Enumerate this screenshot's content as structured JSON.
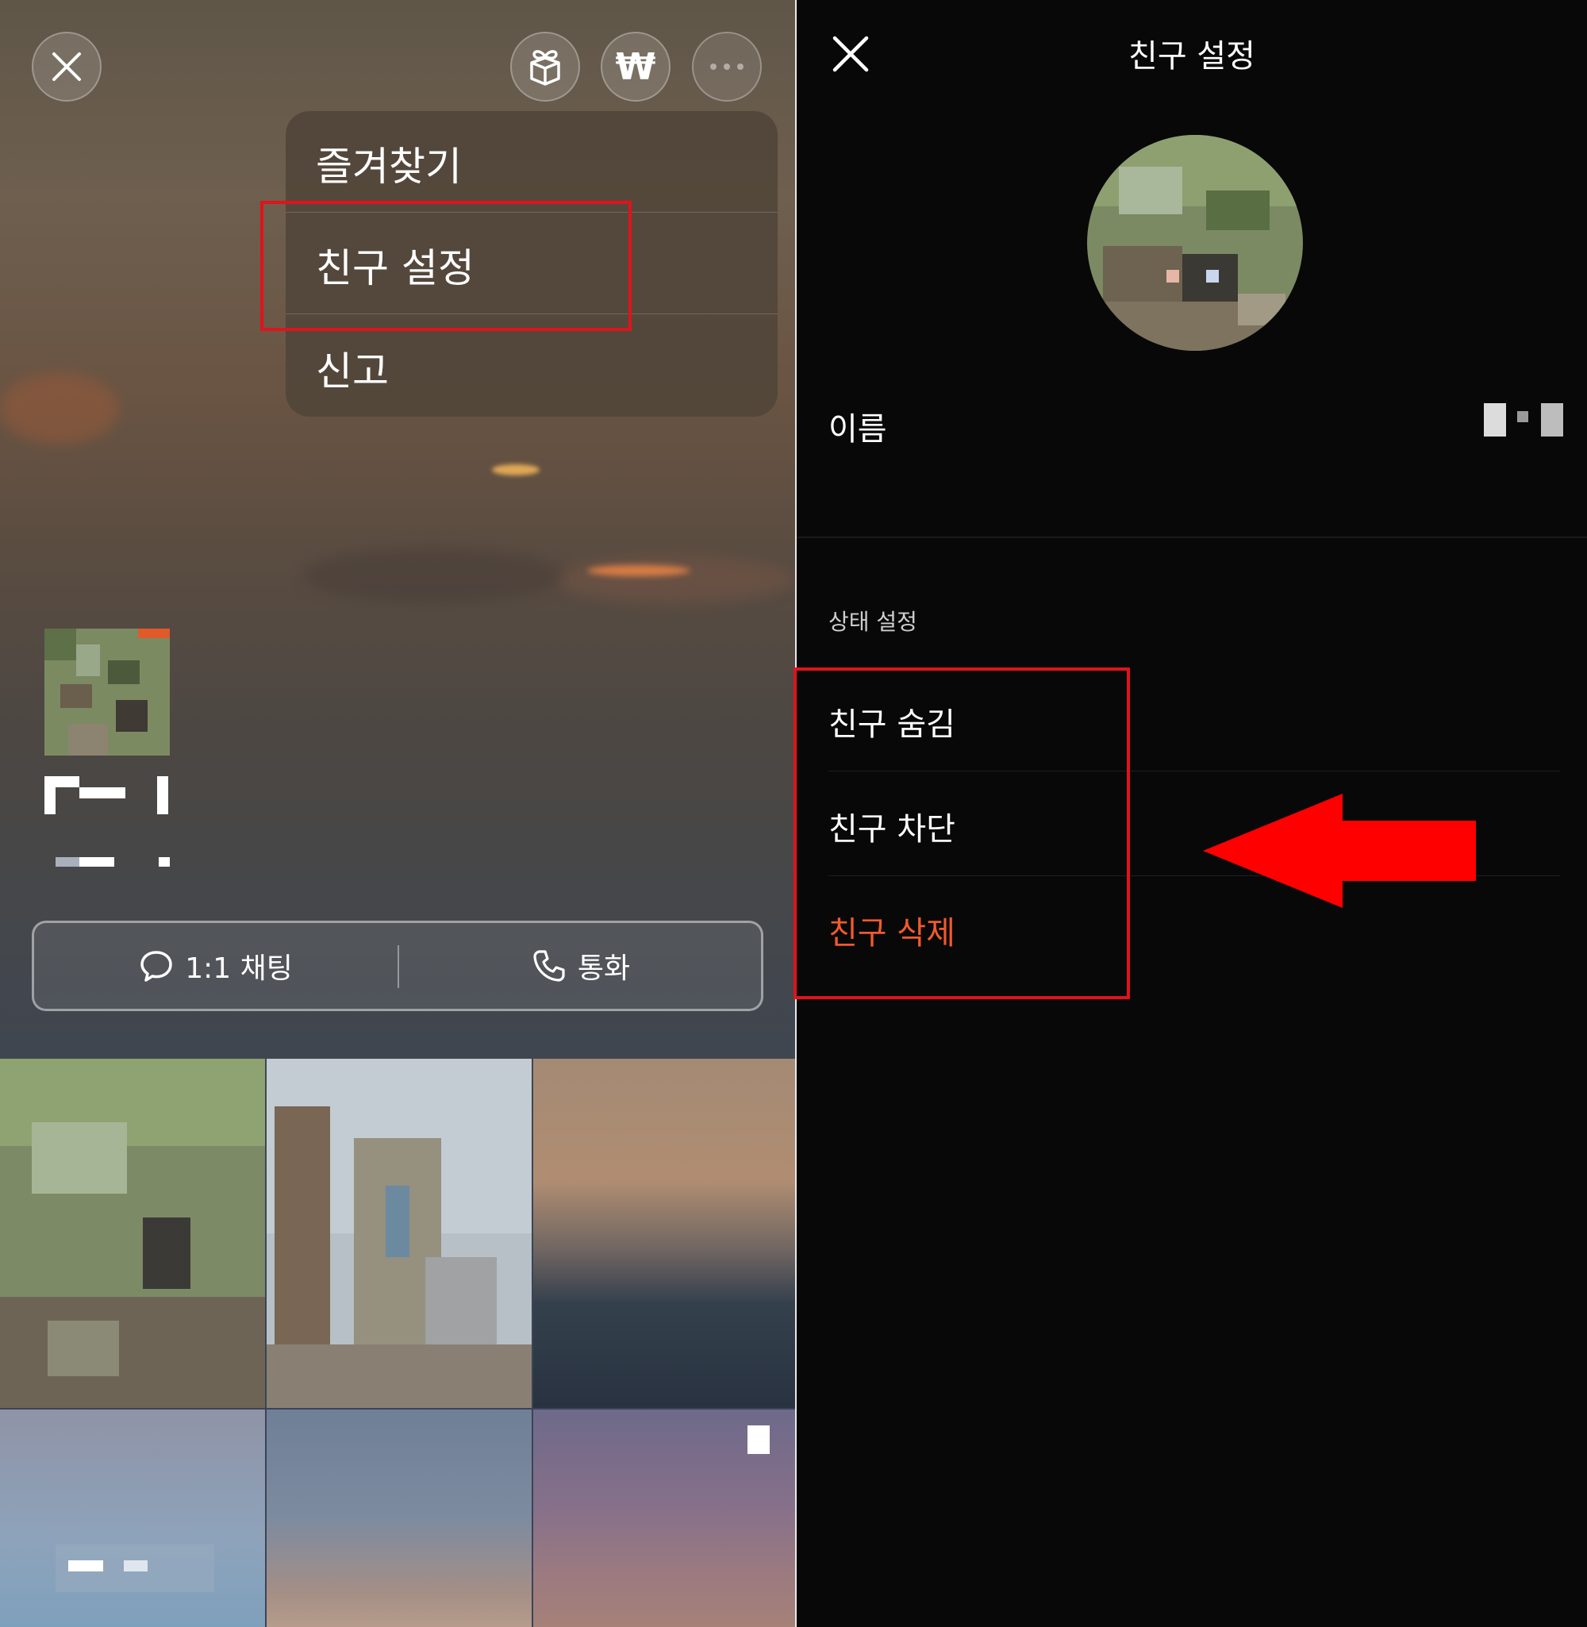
{
  "left": {
    "menu": {
      "items": [
        "즐겨찾기",
        "친구 설정",
        "신고"
      ]
    },
    "top_buttons": {
      "close_icon": "close-icon",
      "gift_icon": "gift-icon",
      "money_icon": "won-icon",
      "money_symbol": "₩",
      "more_icon": "more-icon"
    },
    "actions": {
      "chat_label": "1:1 채팅",
      "call_label": "통화"
    }
  },
  "right": {
    "title": "친구 설정",
    "name_label": "이름",
    "section_label": "상태 설정",
    "items": {
      "hide": "친구 숨김",
      "block": "친구 차단",
      "delete": "친구 삭제"
    },
    "colors": {
      "delete": "#f25a2c",
      "highlight": "#e0131b",
      "arrow": "#ff0000"
    }
  }
}
